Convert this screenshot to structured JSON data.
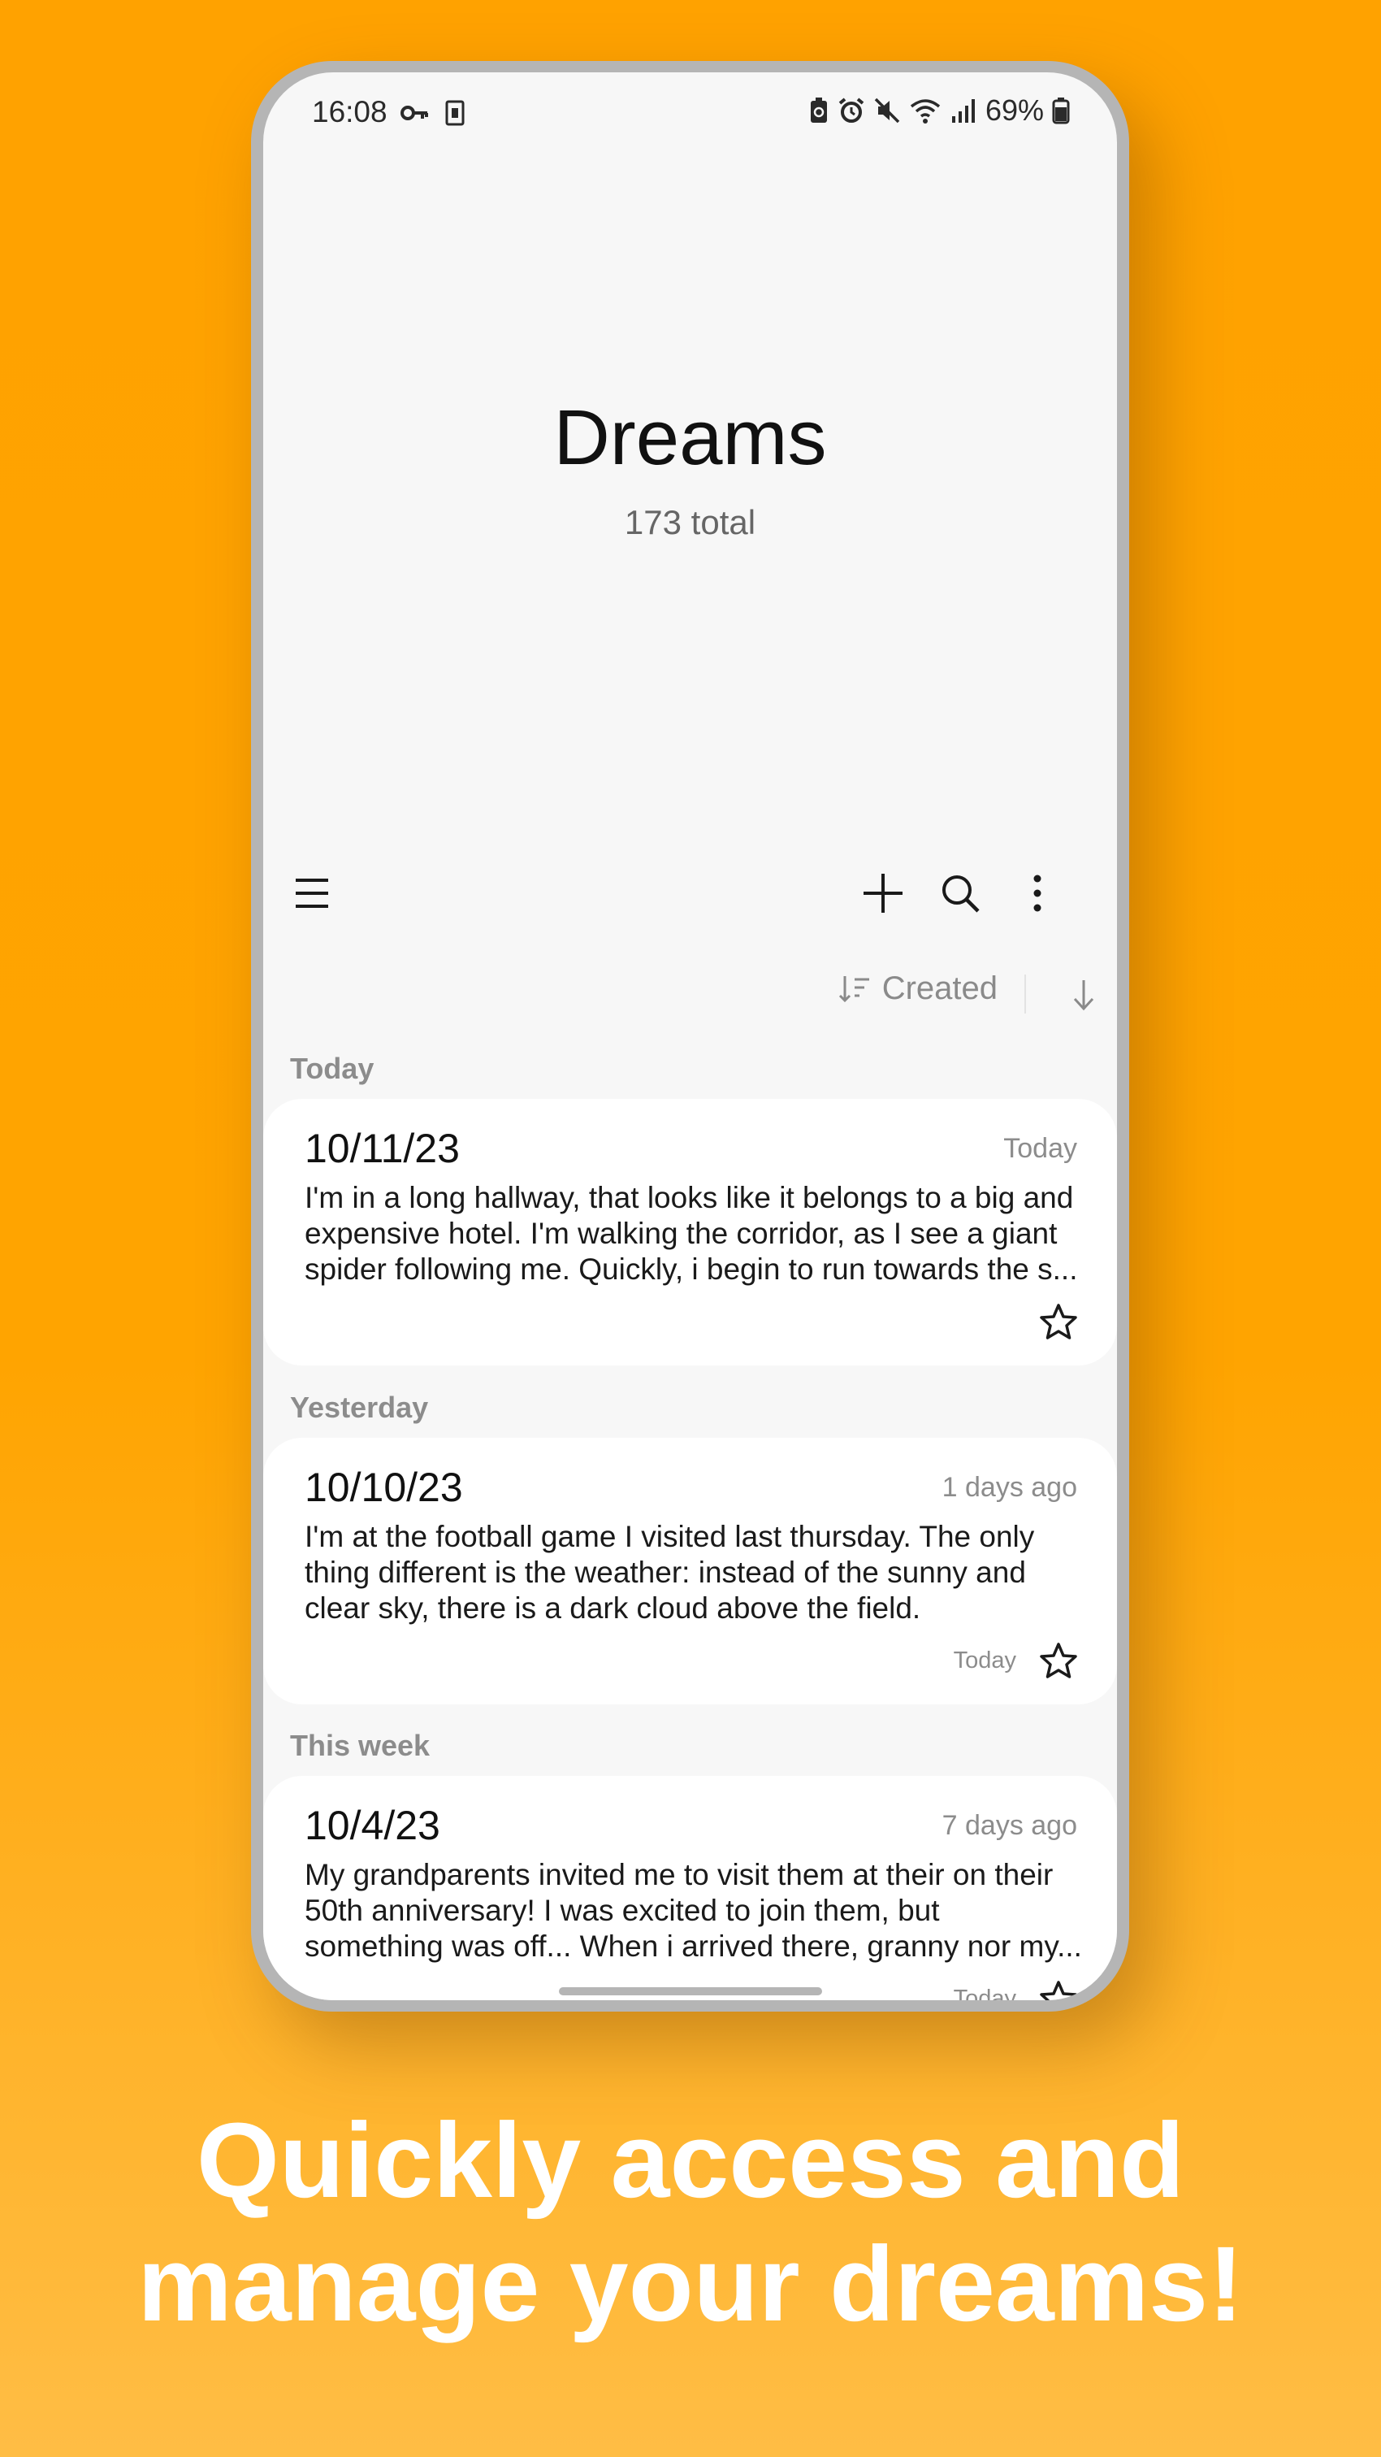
{
  "status_bar": {
    "time": "16:08",
    "battery": "69%",
    "left_icons": [
      "key-icon",
      "sim-icon"
    ],
    "right_icons": [
      "battery-saver-icon",
      "alarm-icon",
      "mute-icon",
      "wifi-icon",
      "signal-icon",
      "battery-icon"
    ]
  },
  "header": {
    "title": "Dreams",
    "count": "173 total"
  },
  "toolbar": {
    "icons": [
      "menu-icon",
      "add-icon",
      "search-icon",
      "more-vert-icon"
    ]
  },
  "sort": {
    "label": "Created"
  },
  "sections": [
    {
      "label": "Today",
      "entry": {
        "date": "10/11/23",
        "ago": "Today",
        "lines": [
          "I'm in a long hallway, that looks like it belongs to a big and",
          "expensive hotel. I'm walking the corridor, as I see a giant",
          "spider following me. Quickly, i begin to run towards the s..."
        ],
        "modified": ""
      }
    },
    {
      "label": "Yesterday",
      "entry": {
        "date": "10/10/23",
        "ago": "1 days ago",
        "lines": [
          "I'm at the football game I visited last thursday. The only",
          "thing different is the weather: instead of the sunny and",
          "clear sky, there is a dark cloud above the field."
        ],
        "modified": "Today"
      }
    },
    {
      "label": "This week",
      "entry": {
        "date": "10/4/23",
        "ago": "7 days ago",
        "lines": [
          "My grandparents invited me to visit them at their on their",
          "50th anniversary! I was excited to join them, but",
          "something was off... When i arrived there, granny nor my..."
        ],
        "modified": "Today"
      }
    }
  ],
  "caption": {
    "line1": "Quickly access and",
    "line2": "manage your dreams!"
  },
  "colors": {
    "background": "#ffa200",
    "caption_text": "#ffffff",
    "screen": "#f7f7f7",
    "card": "#ffffff"
  }
}
